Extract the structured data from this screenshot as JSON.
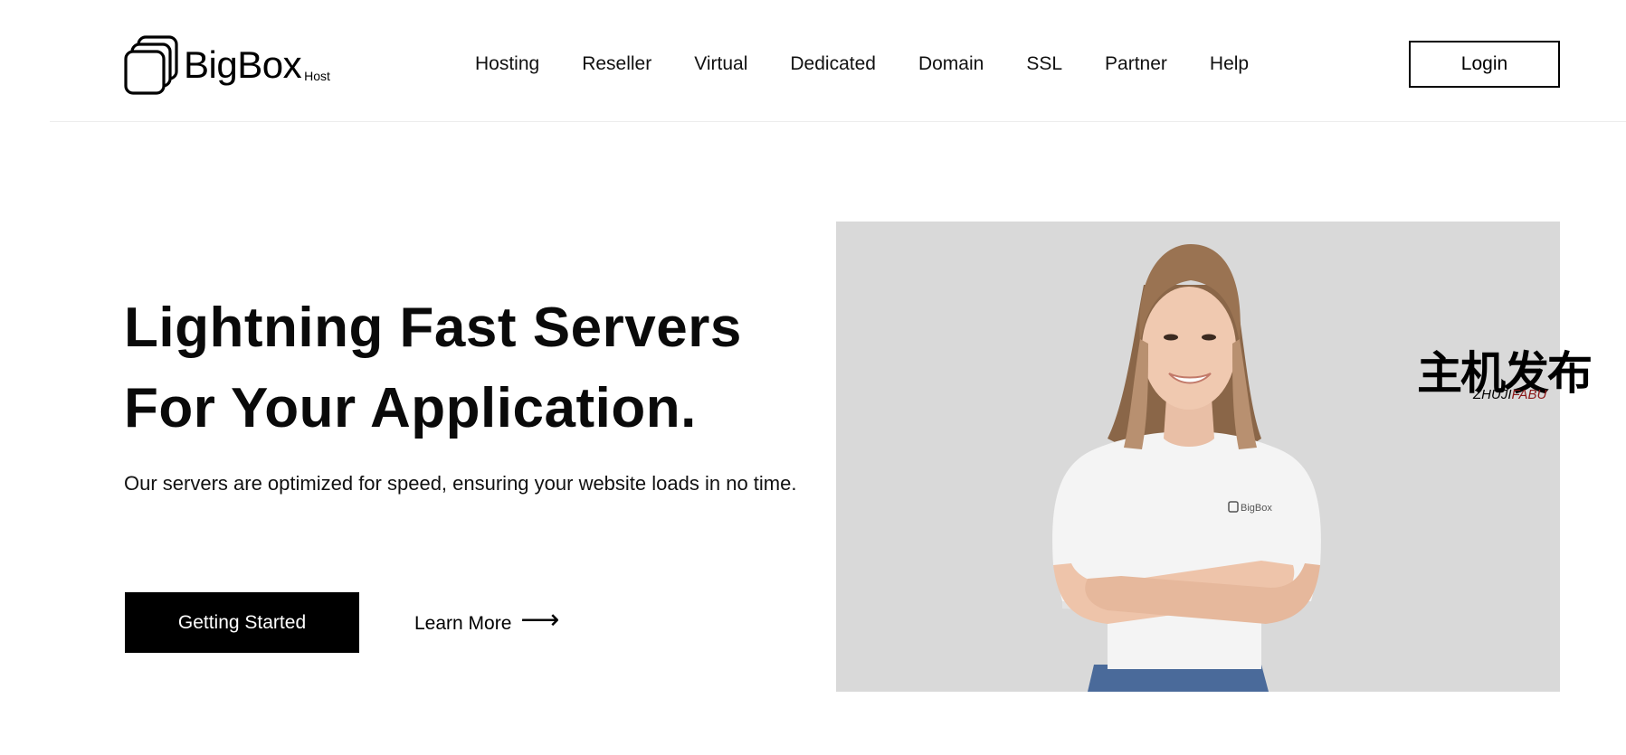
{
  "header": {
    "logo": {
      "word": "BigBox",
      "sub": "Host"
    },
    "nav": [
      {
        "label": "Hosting"
      },
      {
        "label": "Reseller"
      },
      {
        "label": "Virtual"
      },
      {
        "label": "Dedicated"
      },
      {
        "label": "Domain"
      },
      {
        "label": "SSL"
      },
      {
        "label": "Partner"
      },
      {
        "label": "Help"
      }
    ],
    "login_label": "Login"
  },
  "hero": {
    "title_line1": "Lightning Fast Servers",
    "title_line2": "For Your Application.",
    "description": "Our servers are optimized for speed, ensuring your website loads in no time.",
    "primary_cta": "Getting Started",
    "secondary_cta": "Learn More",
    "secondary_cta_arrow": "⟶",
    "image": {
      "background_color": "#d9d9d9",
      "shirt_logo_text": "BigBox"
    }
  },
  "watermark": {
    "cn": "主机发布",
    "en_part1": "ZHUJI",
    "en_part2": "FABU"
  },
  "colors": {
    "primary": "#000000",
    "background": "#ffffff",
    "image_bg": "#d9d9d9",
    "watermark_red": "#8b1a1a"
  }
}
